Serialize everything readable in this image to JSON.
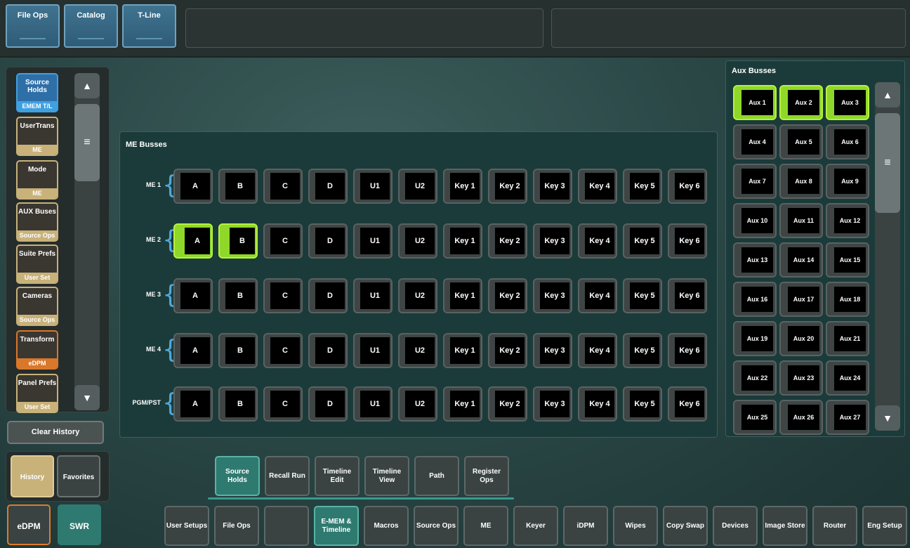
{
  "top_tabs": [
    "File Ops",
    "Catalog",
    "T-Line"
  ],
  "history": {
    "items": [
      {
        "label": "Source Holds",
        "sub": "EMEM T/L",
        "color": "#2f6fa8",
        "subcolor": "#3fa0e0"
      },
      {
        "label": "UserTrans",
        "sub": "ME",
        "color": "#3a3630",
        "subcolor": "#c8b27a"
      },
      {
        "label": "Mode",
        "sub": "ME",
        "color": "#3a3630",
        "subcolor": "#c8b27a"
      },
      {
        "label": "AUX Buses",
        "sub": "Source Ops",
        "color": "#3a3630",
        "subcolor": "#c8b27a"
      },
      {
        "label": "Suite Prefs",
        "sub": "User Set",
        "color": "#3a3630",
        "subcolor": "#c8b27a"
      },
      {
        "label": "Cameras",
        "sub": "Source Ops",
        "color": "#3a3630",
        "subcolor": "#c8b27a"
      },
      {
        "label": "Transform",
        "sub": "eDPM",
        "color": "#3a3630",
        "subcolor": "#d9772a"
      },
      {
        "label": "Panel Prefs",
        "sub": "User Set",
        "color": "#3a3630",
        "subcolor": "#c8b27a"
      }
    ],
    "clear_label": "Clear History",
    "tab_history": "History",
    "tab_favorites": "Favorites"
  },
  "modes": {
    "edpm": "eDPM",
    "swr": "SWR"
  },
  "me_panel": {
    "title": "ME Busses",
    "buttons": [
      "A",
      "B",
      "C",
      "D",
      "U1",
      "U2",
      "Key 1",
      "Key 2",
      "Key 3",
      "Key 4",
      "Key 5",
      "Key 6"
    ],
    "rows": [
      {
        "label": "ME 1",
        "active": []
      },
      {
        "label": "ME 2",
        "active": [
          0,
          1
        ]
      },
      {
        "label": "ME 3",
        "active": []
      },
      {
        "label": "ME 4",
        "active": []
      },
      {
        "label": "PGM/PST",
        "active": []
      }
    ]
  },
  "aux_panel": {
    "title": "Aux Busses",
    "buttons": [
      "Aux 1",
      "Aux 2",
      "Aux 3",
      "Aux 4",
      "Aux 5",
      "Aux 6",
      "Aux 7",
      "Aux 8",
      "Aux 9",
      "Aux 10",
      "Aux 11",
      "Aux 12",
      "Aux 13",
      "Aux 14",
      "Aux 15",
      "Aux 16",
      "Aux 17",
      "Aux 18",
      "Aux 19",
      "Aux 20",
      "Aux 21",
      "Aux 22",
      "Aux 23",
      "Aux 24",
      "Aux 25",
      "Aux 26",
      "Aux 27"
    ],
    "active": [
      0,
      1,
      2
    ]
  },
  "sub_tabs": [
    {
      "label": "Source Holds",
      "active": true
    },
    {
      "label": "Recall Run",
      "active": false
    },
    {
      "label": "Timeline Edit",
      "active": false
    },
    {
      "label": "Timeline View",
      "active": false
    },
    {
      "label": "Path",
      "active": false
    },
    {
      "label": "Register Ops",
      "active": false
    }
  ],
  "nav": [
    {
      "label": "User Setups",
      "active": false
    },
    {
      "label": "File Ops",
      "active": false
    },
    {
      "label": "",
      "active": false
    },
    {
      "label": "E-MEM & Timeline",
      "active": true
    },
    {
      "label": "Macros",
      "active": false
    },
    {
      "label": "Source Ops",
      "active": false
    },
    {
      "label": "ME",
      "active": false
    },
    {
      "label": "Keyer",
      "active": false
    },
    {
      "label": "iDPM",
      "active": false
    },
    {
      "label": "Wipes",
      "active": false
    },
    {
      "label": "Copy Swap",
      "active": false
    },
    {
      "label": "Devices",
      "active": false
    },
    {
      "label": "Image Store",
      "active": false
    },
    {
      "label": "Router",
      "active": false
    },
    {
      "label": "Eng Setup",
      "active": false
    }
  ]
}
